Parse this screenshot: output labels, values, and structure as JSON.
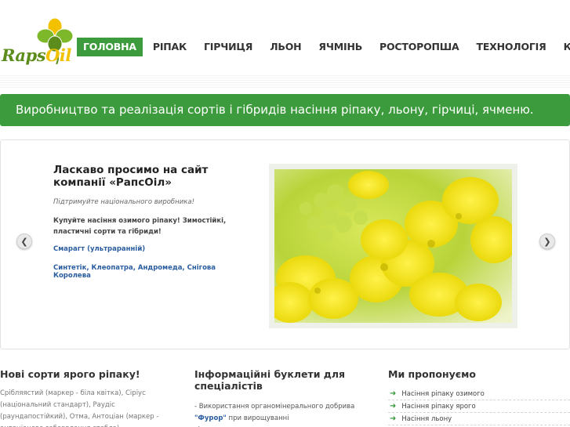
{
  "logo": {
    "text_main": "Raps",
    "text_accent": "Oil"
  },
  "nav": {
    "items": [
      {
        "label": "ГОЛОВНА"
      },
      {
        "label": "РІПАК"
      },
      {
        "label": "ГІРЧИЦЯ"
      },
      {
        "label": "ЛЬОН"
      },
      {
        "label": "ЯЧМІНЬ"
      },
      {
        "label": "РОСТОРОПША"
      },
      {
        "label": "ТЕХНОЛОГІЯ"
      },
      {
        "label": "КОНТАКТИ"
      }
    ]
  },
  "banner": {
    "text": "Виробництво та реалізація сортів і гібридів насіння ріпаку, льону, гірчиці, ячменю."
  },
  "slider": {
    "title": "Ласкаво просимо на сайт компанії «РапсОіл»",
    "subtitle": "Підтримуйте національного виробника!",
    "paragraph": "Купуйте насіння озимого ріпаку! Зимостійкі, пластичні сорти та гібриди!",
    "link1": "Смарагт (ультраранній)",
    "link2": "Синтетік, Клеопатра, Андромеда, Снігова Королева",
    "prev_icon": "chevron-left-icon",
    "next_icon": "chevron-right-icon"
  },
  "columns": {
    "col1": {
      "title": "Нові сорти ярого ріпаку!",
      "text": "Срібляястий (маркер - біла квітка), Сіріус (національний стандарт), Раудіс (раундапостійкий), Отма, Антоціан (маркер - антоціанове забарвлення стебла)"
    },
    "col2": {
      "title": "Інформаційні буклети для спеціалістів",
      "text_before": "- Використання органомінерального добрива ",
      "text_bold": "\"Фурор\"",
      "text_after": " при вирощуванні сільськогосподарських культур"
    },
    "col3": {
      "title": "Ми пропонуємо",
      "items": [
        {
          "label": "Насіння ріпаку озимого"
        },
        {
          "label": "Насіння ріпаку ярого"
        },
        {
          "label": "Насіння льону"
        }
      ]
    }
  },
  "colors": {
    "accent": "#3c9b3c",
    "link": "#2a5d9f"
  }
}
